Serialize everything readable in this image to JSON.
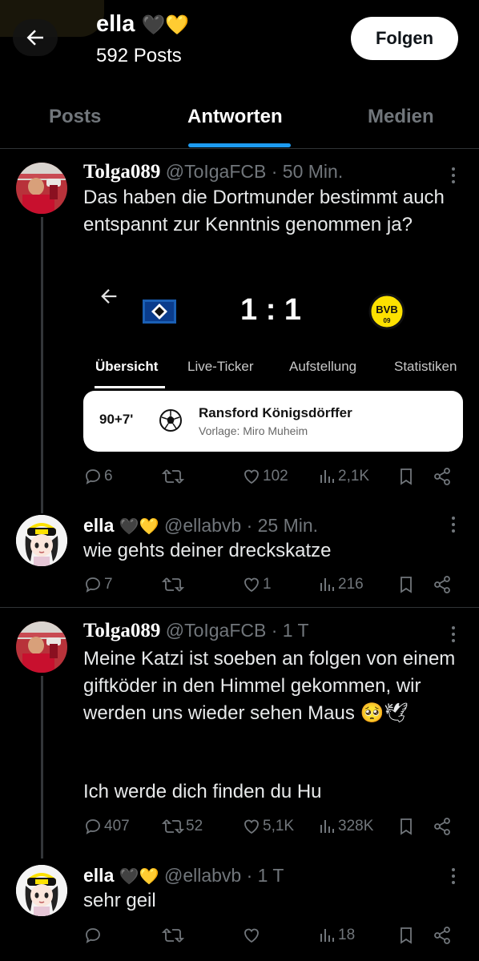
{
  "header": {
    "name": "ella",
    "name_emojis": "🖤💛",
    "posts_count": "592 Posts",
    "follow_label": "Folgen"
  },
  "tabs": [
    {
      "label": "Posts",
      "active": false
    },
    {
      "label": "Antworten",
      "active": true
    },
    {
      "label": "Medien",
      "active": false
    }
  ],
  "tweets": [
    {
      "name": "Tolga089",
      "handle": "@ToIgaFCB",
      "time": "· 50 Min.",
      "text": "Das haben die Dortmunder bestimmt auch entspannt zur Kenntnis genommen ja?",
      "embed": {
        "score": "1 : 1",
        "tabs": [
          "Übersicht",
          "Live-Ticker",
          "Aufstellung",
          "Statistiken"
        ],
        "minute": "90+7'",
        "scorer": "Ransford Königsdörffer",
        "assist": "Vorlage: Miro Muheim",
        "home_badge": "hsv-flag-icon",
        "away_badge": "bvb-logo-icon",
        "away_badge_text": "BVB",
        "away_badge_year": "09"
      },
      "replies": "6",
      "reposts": "",
      "likes": "102",
      "views": "2,1K"
    },
    {
      "name": "ella",
      "name_emojis": "🖤💛",
      "handle": "@ellabvb",
      "time": "· 25 Min.",
      "text": "wie gehts deiner dreckskatze",
      "replies": "7",
      "reposts": "",
      "likes": "1",
      "views": "216"
    },
    {
      "name": "Tolga089",
      "handle": "@ToIgaFCB",
      "time": "· 1 T",
      "text": "Meine Katzi ist soeben an folgen von einem giftköder in den Himmel gekommen, wir werden uns wieder sehen Maus 🥺🕊",
      "text2": "Ich werde dich finden du Hu",
      "replies": "407",
      "reposts": "52",
      "likes": "5,1K",
      "views": "328K"
    },
    {
      "name": "ella",
      "name_emojis": "🖤💛",
      "handle": "@ellabvb",
      "time": "· 1 T",
      "text": "sehr geil",
      "replies": "",
      "reposts": "",
      "likes": "",
      "views": "18"
    }
  ],
  "colors": {
    "accent": "#1d9bf0",
    "muted": "#71767b",
    "background": "#000000",
    "bvb_yellow": "#fde100"
  }
}
